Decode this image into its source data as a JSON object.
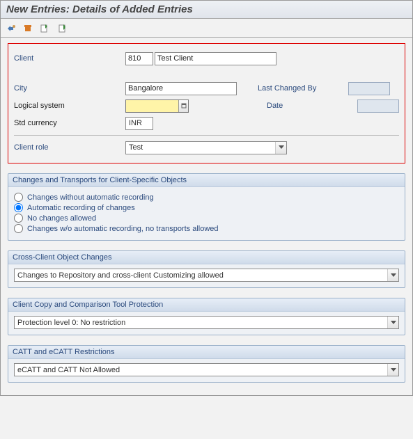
{
  "title": "New Entries: Details of Added Entries",
  "form": {
    "client_label": "Client",
    "client_value": "810",
    "client_name": "Test Client",
    "city_label": "City",
    "city_value": "Bangalore",
    "last_changed_by_label": "Last Changed By",
    "last_changed_by_value": "",
    "logical_system_label": "Logical system",
    "logical_system_value": "",
    "date_label": "Date",
    "date_value": "",
    "std_currency_label": "Std currency",
    "std_currency_value": "INR",
    "client_role_label": "Client role",
    "client_role_value": "Test"
  },
  "groups": {
    "changes": {
      "title": "Changes and Transports for Client-Specific Objects",
      "options": [
        "Changes without automatic recording",
        "Automatic recording of changes",
        "No changes allowed",
        "Changes w/o automatic recording, no transports allowed"
      ],
      "selected": 1
    },
    "cross_client": {
      "title": "Cross-Client Object Changes",
      "value": "Changes to Repository and cross-client Customizing allowed"
    },
    "copy_protection": {
      "title": "Client Copy and Comparison Tool Protection",
      "value": "Protection level 0: No restriction"
    },
    "catt": {
      "title": "CATT and eCATT Restrictions",
      "value": "eCATT and CATT Not Allowed"
    }
  }
}
